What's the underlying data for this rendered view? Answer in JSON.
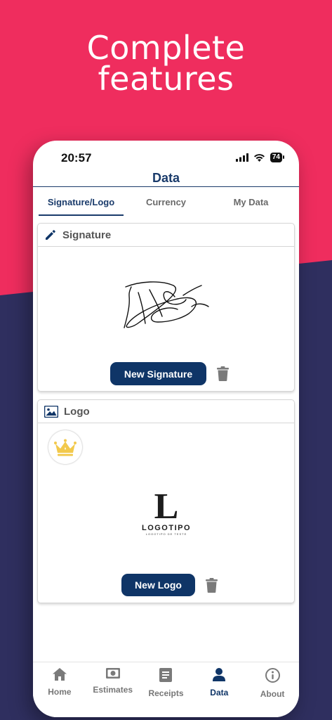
{
  "headline": {
    "line1": "Complete",
    "line2": "features"
  },
  "status_bar": {
    "time": "20:57",
    "battery": "74"
  },
  "nav": {
    "title": "Data"
  },
  "tabs": [
    {
      "label": "Signature/Logo",
      "active": true
    },
    {
      "label": "Currency",
      "active": false
    },
    {
      "label": "My Data",
      "active": false
    }
  ],
  "signature_card": {
    "title": "Signature",
    "button_label": "New Signature",
    "icon": "pencil-icon"
  },
  "logo_card": {
    "title": "Logo",
    "button_label": "New Logo",
    "icon": "image-icon",
    "logo_letter": "L",
    "logo_name": "LOGOTIPO",
    "logo_tagline": "LOGOTIPO DE TESTE"
  },
  "bottom_nav": [
    {
      "label": "Home",
      "icon": "home-icon"
    },
    {
      "label": "Estimates",
      "icon": "money-icon"
    },
    {
      "label": "Receipts",
      "icon": "receipt-icon"
    },
    {
      "label": "Data",
      "icon": "person-icon",
      "active": true
    },
    {
      "label": "About",
      "icon": "info-icon"
    }
  ],
  "colors": {
    "brand_pink": "#ef2d5e",
    "navy_bg": "#2f2f5f",
    "primary": "#0f3567",
    "crown": "#f2c94c"
  }
}
